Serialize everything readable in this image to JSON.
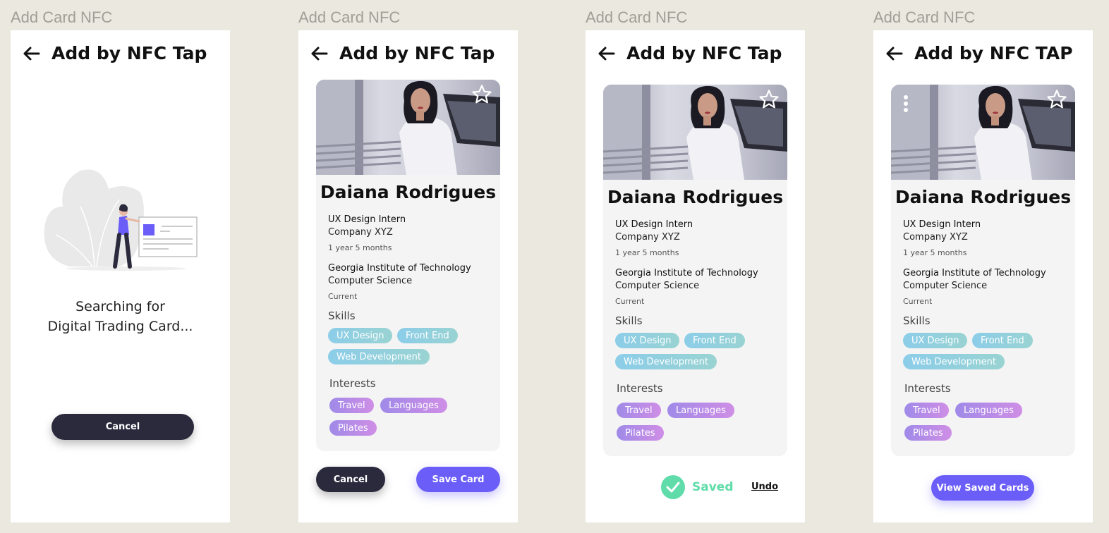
{
  "frame_label": "Add Card NFC",
  "screens": [
    {
      "title": "Add by NFC Tap",
      "searching_line1": "Searching for",
      "searching_line2": "Digital Trading Card...",
      "cancel_label": "Cancel"
    },
    {
      "title": "Add by NFC Tap",
      "cancel_label": "Cancel",
      "save_label": "Save Card"
    },
    {
      "title": "Add by NFC Tap",
      "saved_label": "Saved",
      "undo_label": "Undo"
    },
    {
      "title": "Add by NFC TAP",
      "view_saved_label": "View Saved Cards"
    }
  ],
  "card": {
    "name": "Daiana Rodrigues",
    "job_title": "UX Design Intern",
    "company": "Company XYZ",
    "duration": "1 year 5 months",
    "school": "Georgia Institute of Technology",
    "major": "Computer Science",
    "status": "Current",
    "skills_heading": "Skills",
    "skills": [
      "UX Design",
      "Front End",
      "Web Development"
    ],
    "interests_heading": "Interests",
    "interests": [
      "Travel",
      "Languages",
      "Pilates"
    ]
  },
  "colors": {
    "accent": "#6a5df8",
    "dark_button": "#2b2a3d",
    "success": "#5fdca9",
    "canvas": "#ebe9df"
  }
}
